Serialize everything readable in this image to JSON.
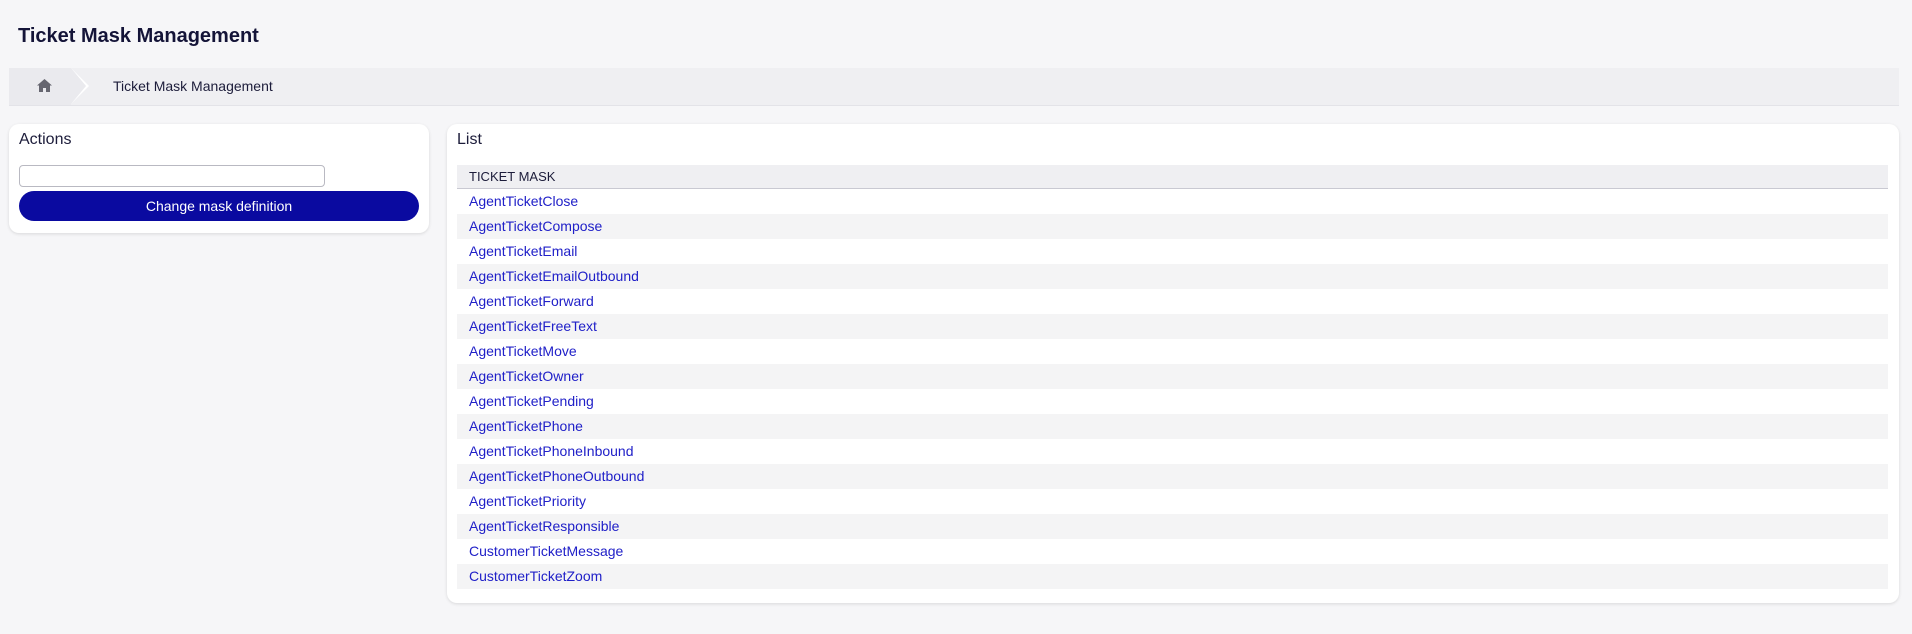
{
  "page": {
    "title": "Ticket Mask Management"
  },
  "breadcrumb": {
    "home_icon": "home-icon",
    "current": "Ticket Mask Management"
  },
  "actions": {
    "title": "Actions",
    "select_value": "",
    "button_label": "Change mask definition"
  },
  "list": {
    "title": "List",
    "column_header": "TICKET MASK",
    "items": [
      "AgentTicketClose",
      "AgentTicketCompose",
      "AgentTicketEmail",
      "AgentTicketEmailOutbound",
      "AgentTicketForward",
      "AgentTicketFreeText",
      "AgentTicketMove",
      "AgentTicketOwner",
      "AgentTicketPending",
      "AgentTicketPhone",
      "AgentTicketPhoneInbound",
      "AgentTicketPhoneOutbound",
      "AgentTicketPriority",
      "AgentTicketResponsible",
      "CustomerTicketMessage",
      "CustomerTicketZoom"
    ]
  },
  "colors": {
    "accent": "#0a0aa0",
    "link": "#2020c8",
    "background": "#f6f6f8"
  }
}
